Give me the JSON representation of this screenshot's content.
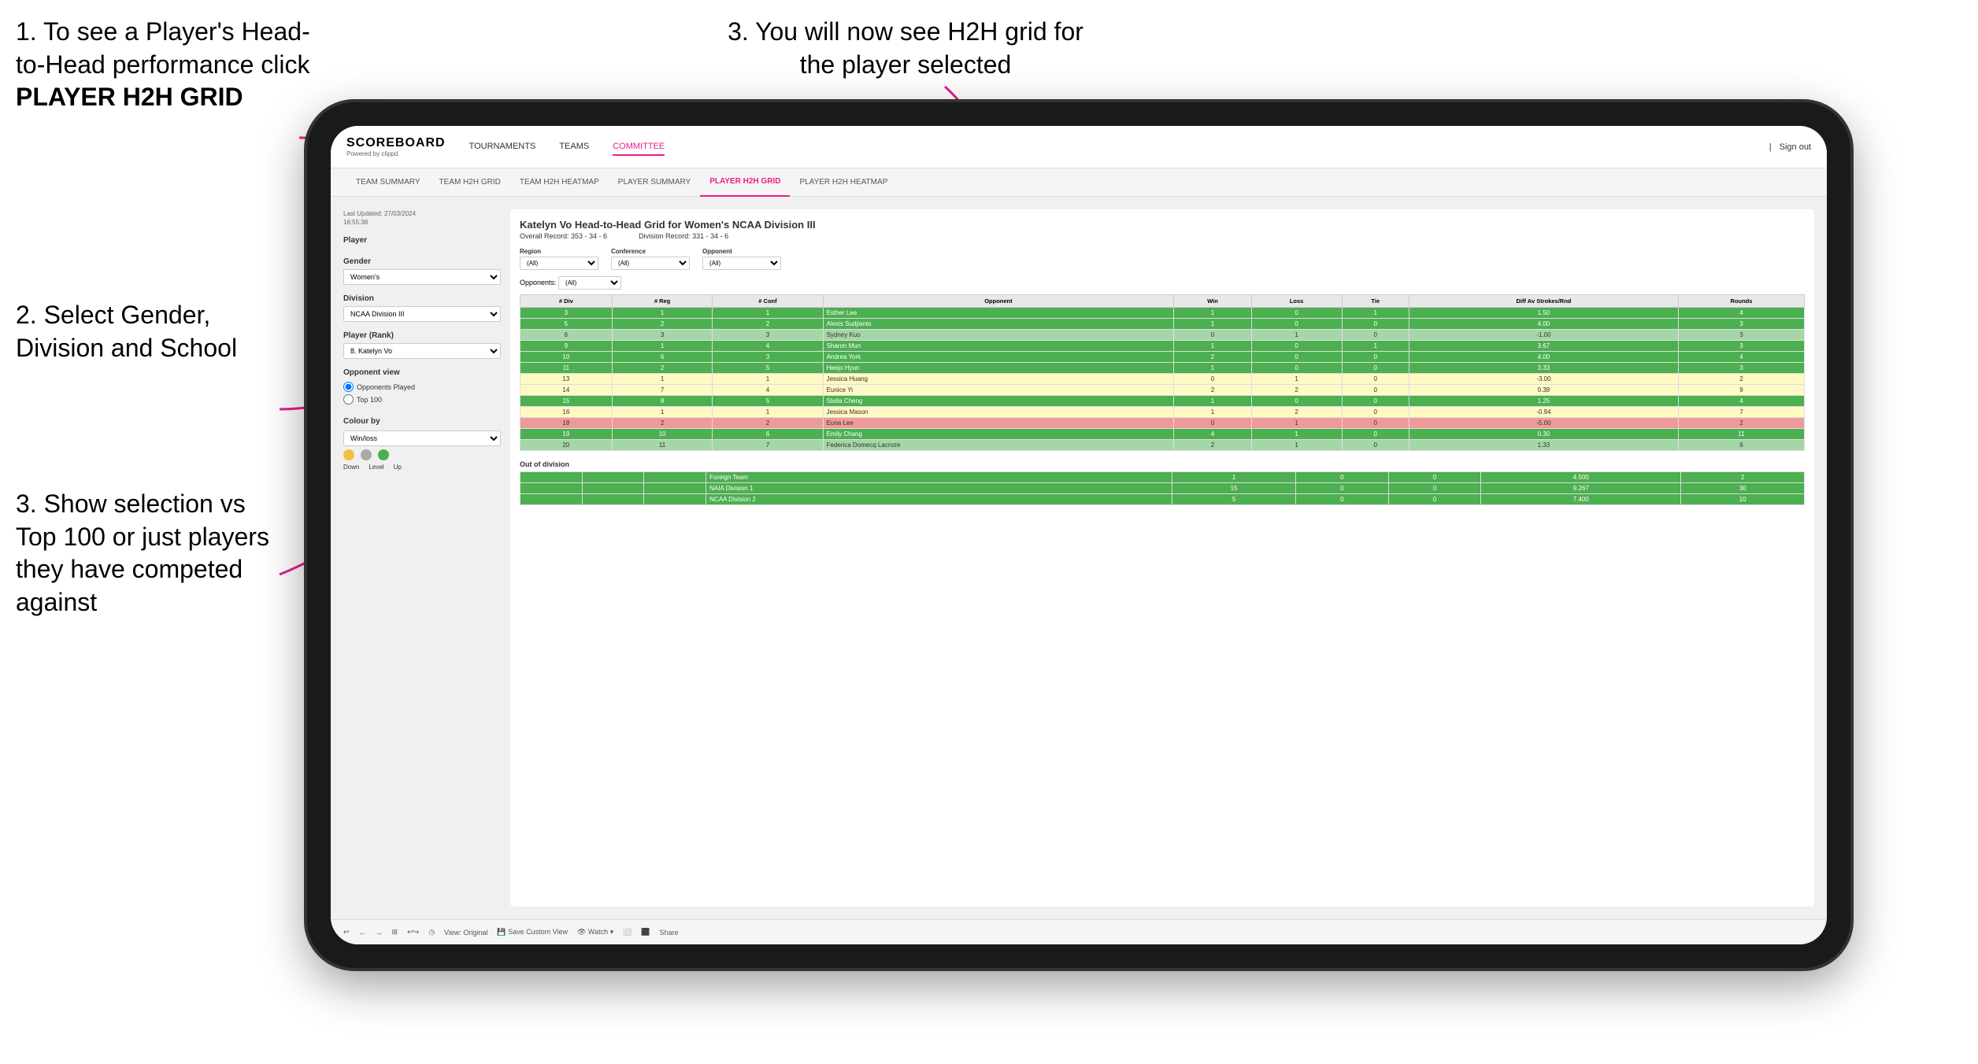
{
  "instructions": {
    "step1_text": "1. To see a Player's Head-to-Head performance click",
    "step1_bold": "PLAYER H2H GRID",
    "step2_text": "2. Select Gender, Division and School",
    "step3_right_text": "3. You will now see H2H grid for the player selected",
    "step3_left_text": "3. Show selection vs Top 100 or just players they have competed against"
  },
  "nav": {
    "logo": "SCOREBOARD",
    "powered": "Powered by clippd",
    "links": [
      "TOURNAMENTS",
      "TEAMS",
      "COMMITTEE",
      ""
    ],
    "active_link": "COMMITTEE",
    "sign_out": "Sign out"
  },
  "sub_nav": {
    "links": [
      "TEAM SUMMARY",
      "TEAM H2H GRID",
      "TEAM H2H HEATMAP",
      "PLAYER SUMMARY",
      "PLAYER H2H GRID",
      "PLAYER H2H HEATMAP"
    ],
    "active": "PLAYER H2H GRID"
  },
  "sidebar": {
    "timestamp": "Last Updated: 27/03/2024\n16:55:38",
    "player_label": "Player",
    "gender_label": "Gender",
    "gender_value": "Women's",
    "division_label": "Division",
    "division_value": "NCAA Division III",
    "player_rank_label": "Player (Rank)",
    "player_rank_value": "8. Katelyn Vo",
    "opponent_view_label": "Opponent view",
    "radio_options": [
      "Opponents Played",
      "Top 100"
    ],
    "colour_by_label": "Colour by",
    "colour_by_value": "Win/loss",
    "legend": [
      {
        "color": "#f0c040",
        "label": "Down"
      },
      {
        "color": "#aaaaaa",
        "label": "Level"
      },
      {
        "color": "#4caf50",
        "label": "Up"
      }
    ]
  },
  "grid": {
    "title": "Katelyn Vo Head-to-Head Grid for Women's NCAA Division III",
    "overall_record": "Overall Record: 353 - 34 - 6",
    "division_record": "Division Record: 331 - 34 - 6",
    "filter_groups": [
      {
        "label": "Region",
        "options": [
          "(All)"
        ],
        "value": "(All)"
      },
      {
        "label": "Conference",
        "options": [
          "(All)"
        ],
        "value": "(All)"
      },
      {
        "label": "Opponent",
        "options": [
          "(All)"
        ],
        "value": "(All)"
      }
    ],
    "opponents_label": "Opponents:",
    "opponents_value": "(All)",
    "col_headers": [
      "# Div",
      "# Reg",
      "# Conf",
      "Opponent",
      "Win",
      "Loss",
      "Tie",
      "Diff Av Strokes/Rnd",
      "Rounds"
    ],
    "rows": [
      {
        "div": "3",
        "reg": "1",
        "conf": "1",
        "opponent": "Esther Lee",
        "win": "1",
        "loss": "0",
        "tie": "1",
        "diff": "1.50",
        "rounds": "4",
        "color": "green-dark"
      },
      {
        "div": "5",
        "reg": "2",
        "conf": "2",
        "opponent": "Alexis Sudjianto",
        "win": "1",
        "loss": "0",
        "tie": "0",
        "diff": "4.00",
        "rounds": "3",
        "color": "green-dark"
      },
      {
        "div": "6",
        "reg": "3",
        "conf": "3",
        "opponent": "Sydney Kuo",
        "win": "0",
        "loss": "1",
        "tie": "0",
        "diff": "-1.00",
        "rounds": "3",
        "color": "green-light"
      },
      {
        "div": "9",
        "reg": "1",
        "conf": "4",
        "opponent": "Sharon Mun",
        "win": "1",
        "loss": "0",
        "tie": "1",
        "diff": "3.67",
        "rounds": "3",
        "color": "green-dark"
      },
      {
        "div": "10",
        "reg": "6",
        "conf": "3",
        "opponent": "Andrea York",
        "win": "2",
        "loss": "0",
        "tie": "0",
        "diff": "4.00",
        "rounds": "4",
        "color": "green-dark"
      },
      {
        "div": "11",
        "reg": "2",
        "conf": "5",
        "opponent": "Heejo Hyun",
        "win": "1",
        "loss": "0",
        "tie": "0",
        "diff": "3.33",
        "rounds": "3",
        "color": "green-dark"
      },
      {
        "div": "13",
        "reg": "1",
        "conf": "1",
        "opponent": "Jessica Huang",
        "win": "0",
        "loss": "1",
        "tie": "0",
        "diff": "-3.00",
        "rounds": "2",
        "color": "yellow"
      },
      {
        "div": "14",
        "reg": "7",
        "conf": "4",
        "opponent": "Eunice Yi",
        "win": "2",
        "loss": "2",
        "tie": "0",
        "diff": "0.38",
        "rounds": "9",
        "color": "yellow"
      },
      {
        "div": "15",
        "reg": "8",
        "conf": "5",
        "opponent": "Stella Cheng",
        "win": "1",
        "loss": "0",
        "tie": "0",
        "diff": "1.25",
        "rounds": "4",
        "color": "green-dark"
      },
      {
        "div": "16",
        "reg": "1",
        "conf": "1",
        "opponent": "Jessica Mason",
        "win": "1",
        "loss": "2",
        "tie": "0",
        "diff": "-0.94",
        "rounds": "7",
        "color": "yellow"
      },
      {
        "div": "18",
        "reg": "2",
        "conf": "2",
        "opponent": "Euna Lee",
        "win": "0",
        "loss": "1",
        "tie": "0",
        "diff": "-5.00",
        "rounds": "2",
        "color": "red-light"
      },
      {
        "div": "19",
        "reg": "10",
        "conf": "6",
        "opponent": "Emily Chang",
        "win": "4",
        "loss": "1",
        "tie": "0",
        "diff": "0.30",
        "rounds": "11",
        "color": "green-dark"
      },
      {
        "div": "20",
        "reg": "11",
        "conf": "7",
        "opponent": "Federica Domecq Lacroze",
        "win": "2",
        "loss": "1",
        "tie": "0",
        "diff": "1.33",
        "rounds": "6",
        "color": "green-light"
      }
    ],
    "out_of_division_label": "Out of division",
    "out_of_division_rows": [
      {
        "name": "Foreign Team",
        "win": "1",
        "loss": "0",
        "tie": "0",
        "diff": "4.500",
        "rounds": "2",
        "color": "green-dark"
      },
      {
        "name": "NAIA Division 1",
        "win": "15",
        "loss": "0",
        "tie": "0",
        "diff": "9.267",
        "rounds": "30",
        "color": "green-dark"
      },
      {
        "name": "NCAA Division 2",
        "win": "5",
        "loss": "0",
        "tie": "0",
        "diff": "7.400",
        "rounds": "10",
        "color": "green-dark"
      }
    ]
  },
  "toolbar": {
    "buttons": [
      "↩",
      "←",
      "→",
      "⊞",
      "↩↪",
      "◷",
      "View: Original",
      "Save Custom View",
      "👁 Watch",
      "⬜",
      "⬛",
      "Share"
    ]
  }
}
